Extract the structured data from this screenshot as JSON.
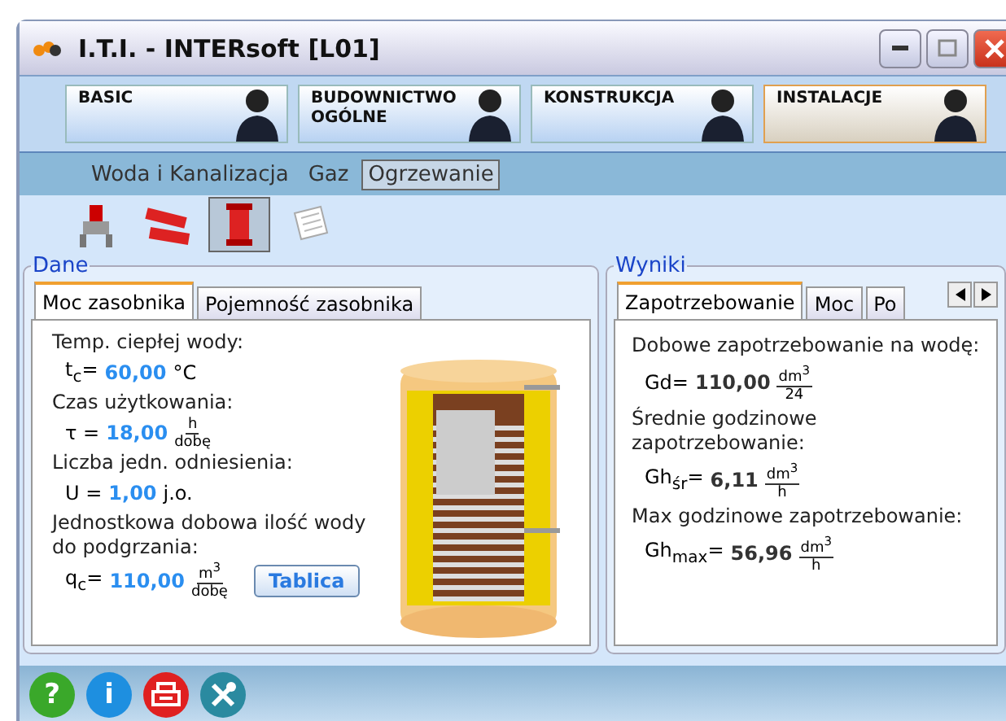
{
  "window": {
    "title": "I.T.I. - INTERsoft [L01]"
  },
  "module_tabs": [
    {
      "label": "BASIC",
      "selected": false
    },
    {
      "label": "BUDOWNICTWO OGÓLNE",
      "selected": false
    },
    {
      "label": "KONSTRUKCJA",
      "selected": false
    },
    {
      "label": "INSTALACJE",
      "selected": true
    }
  ],
  "subnav": [
    {
      "label": "Woda i Kanalizacja",
      "selected": false
    },
    {
      "label": "Gaz",
      "selected": false
    },
    {
      "label": "Ogrzewanie",
      "selected": true
    }
  ],
  "tools": [
    {
      "kind": "valve",
      "selected": false
    },
    {
      "kind": "pipe",
      "selected": false
    },
    {
      "kind": "tank",
      "selected": true
    },
    {
      "kind": "papers",
      "selected": false
    }
  ],
  "data_panel": {
    "title": "Dane",
    "tabs": [
      {
        "label": "Moc zasobnika",
        "selected": true
      },
      {
        "label": "Pojemność zasobnika",
        "selected": false
      }
    ],
    "fields": [
      {
        "label": "Temp. ciepłej wody:",
        "symbol": "t$_{c}$=",
        "value": "60,00",
        "kind": "plain",
        "unit": "°C"
      },
      {
        "label": "Czas użytkowania:",
        "symbol": "τ =",
        "value": "18,00",
        "kind": "fraction",
        "unit_num": "h",
        "unit_den": "dobę"
      },
      {
        "label": "Liczba jedn. odniesienia:",
        "symbol": "U =",
        "value": "1,00",
        "kind": "plain",
        "unit": "j.o."
      },
      {
        "label": "Jednostkowa dobowa ilość wody do podgrzania:",
        "symbol": "q$_{c}$=",
        "value": "110,00",
        "kind": "fraction",
        "unit_num": "m$^{3}$",
        "unit_den": "dobę"
      }
    ],
    "button": "Tablica"
  },
  "results_panel": {
    "title": "Wyniki",
    "tabs": [
      {
        "label": "Zapotrzebowanie",
        "selected": true
      },
      {
        "label": "Moc",
        "selected": false
      },
      {
        "label": "Po",
        "selected": false
      }
    ],
    "results": [
      {
        "label": "Dobowe zapotrzebowanie na wodę:",
        "symbol": "Gd=",
        "value": "110,00",
        "unit_num": "dm$^{3}$",
        "unit_den": "24"
      },
      {
        "label": "Średnie godzinowe zapotrzebowanie:",
        "symbol": "Gh$_{śr}$=",
        "value": "6,11",
        "unit_num": "dm$^{3}$",
        "unit_den": "h"
      },
      {
        "label": "Max godzinowe zapotrzebowanie:",
        "symbol": "Gh$_{max}$=",
        "value": "56,96",
        "unit_num": "dm$^{3}$",
        "unit_den": "h"
      }
    ]
  },
  "footer": [
    {
      "kind": "help",
      "label": "?"
    },
    {
      "kind": "info",
      "label": "i"
    },
    {
      "kind": "print"
    },
    {
      "kind": "tools"
    }
  ]
}
